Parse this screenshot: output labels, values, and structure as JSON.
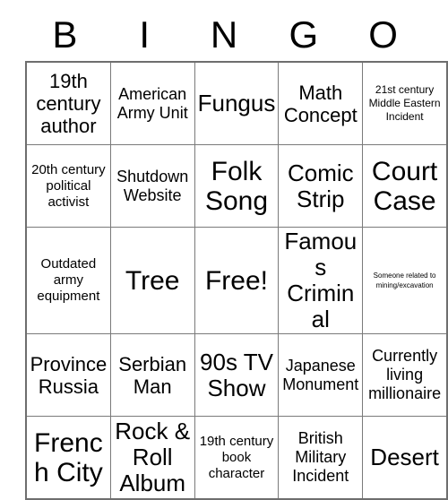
{
  "card": {
    "header_letters": [
      "B",
      "I",
      "N",
      "G",
      "O"
    ],
    "rows": [
      [
        {
          "text": "19th century author",
          "size": "lg"
        },
        {
          "text": "American Army Unit",
          "size": "md"
        },
        {
          "text": "Fungus",
          "size": "xl"
        },
        {
          "text": "Math Concept",
          "size": "lg"
        },
        {
          "text": "21st century Middle Eastern Incident",
          "size": "xs"
        }
      ],
      [
        {
          "text": "20th century political activist",
          "size": "sm"
        },
        {
          "text": "Shutdown Website",
          "size": "md"
        },
        {
          "text": "Folk Song",
          "size": "xxl"
        },
        {
          "text": "Comic Strip",
          "size": "xl"
        },
        {
          "text": "Court Case",
          "size": "xxl"
        }
      ],
      [
        {
          "text": "Outdated army equipment",
          "size": "sm"
        },
        {
          "text": "Tree",
          "size": "xxl"
        },
        {
          "text": "Free!",
          "size": "xxl"
        },
        {
          "text": "Famous Criminal",
          "size": "xl"
        },
        {
          "text": "Someone related to mining/excavation",
          "size": "xxs"
        }
      ],
      [
        {
          "text": "Province Russia",
          "size": "lg"
        },
        {
          "text": "Serbian Man",
          "size": "lg"
        },
        {
          "text": "90s TV Show",
          "size": "xl"
        },
        {
          "text": "Japanese Monument",
          "size": "md"
        },
        {
          "text": "Currently living millionaire",
          "size": "md"
        }
      ],
      [
        {
          "text": "French City",
          "size": "xxl"
        },
        {
          "text": "Rock & Roll Album",
          "size": "xl"
        },
        {
          "text": "19th century book character",
          "size": "sm"
        },
        {
          "text": "British Military Incident",
          "size": "md"
        },
        {
          "text": "Desert",
          "size": "xl"
        }
      ]
    ]
  }
}
